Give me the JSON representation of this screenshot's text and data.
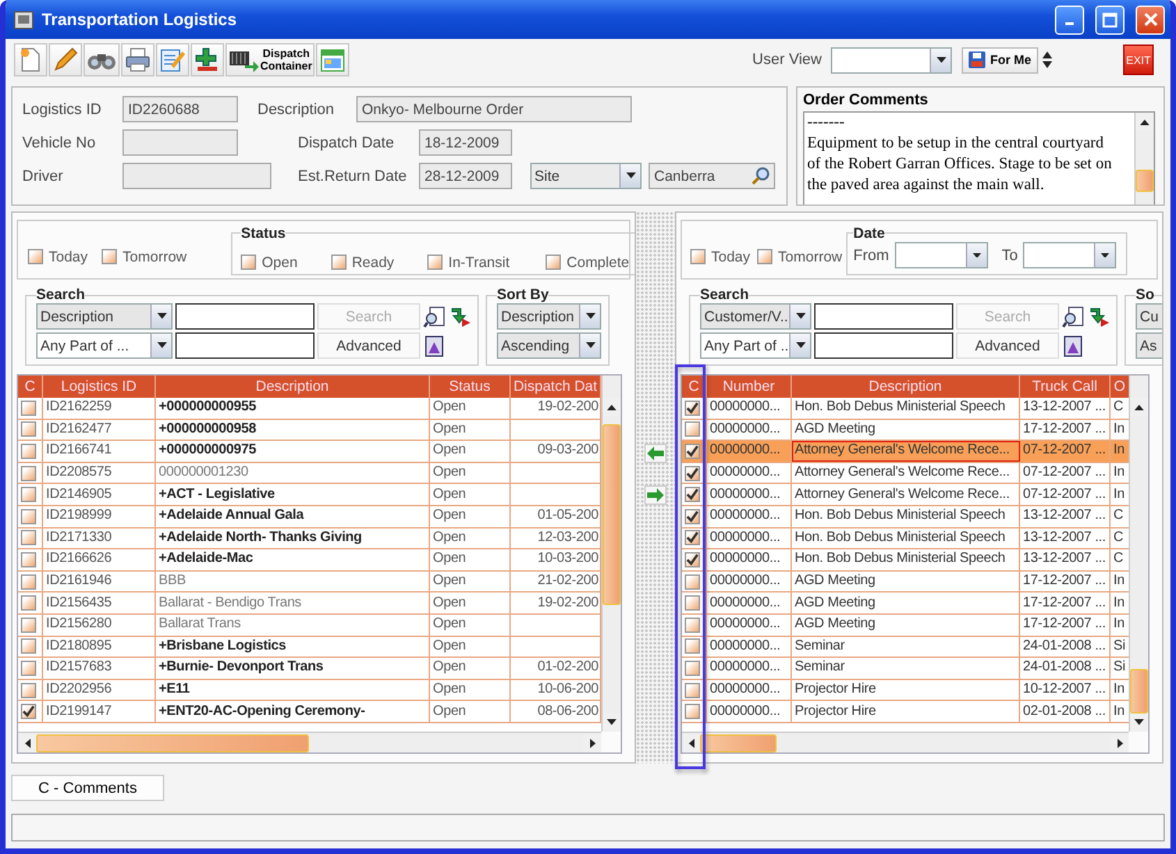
{
  "window": {
    "title": "Transportation Logistics"
  },
  "toolbar": {
    "buttons": [
      {
        "kind": "new"
      },
      {
        "kind": "edit"
      },
      {
        "kind": "find"
      },
      {
        "kind": "print"
      },
      {
        "kind": "notes"
      },
      {
        "kind": "add"
      },
      {
        "kind": "dispatch",
        "label_lines": [
          "Dispatch",
          "Container"
        ]
      },
      {
        "kind": "calendar"
      }
    ],
    "user_view_label": "User View",
    "for_me_button": "For Me",
    "exit_button": "EXIT"
  },
  "header": {
    "logistics_id": {
      "label": "Logistics ID",
      "value": "ID2260688"
    },
    "description": {
      "label": "Description",
      "value": "Onkyo- Melbourne Order"
    },
    "vehicle_no": {
      "label": "Vehicle No"
    },
    "dispatch_date": {
      "label": "Dispatch Date",
      "value": "18-12-2009"
    },
    "driver": {
      "label": "Driver"
    },
    "est_return_date": {
      "label": "Est.Return Date",
      "value": "28-12-2009"
    },
    "site_combo": "Site",
    "location": "Canberra"
  },
  "order_comments": {
    "title": "Order Comments",
    "lines": [
      "-------",
      "Equipment to be setup in the central courtyard",
      "of the Robert Garran Offices. Stage to be set on",
      "the paved area against the main wall."
    ]
  },
  "left_panel": {
    "quick_filters": [
      {
        "label": "Today",
        "checked": false
      },
      {
        "label": "Tomorrow",
        "checked": false
      }
    ],
    "status": {
      "title": "Status",
      "options": [
        {
          "label": "Open",
          "checked": false
        },
        {
          "label": "Ready",
          "checked": false
        },
        {
          "label": "In-Transit",
          "checked": false
        },
        {
          "label": "Complete",
          "checked": false
        }
      ]
    },
    "search": {
      "title": "Search",
      "field_combo": "Description",
      "match_combo": "Any Part of ...",
      "search_button": {
        "label": "Search",
        "disabled": true
      },
      "advanced_button": "Advanced"
    },
    "sort": {
      "title": "Sort By",
      "field": "Description",
      "order": "Ascending"
    },
    "table": {
      "columns": [
        "C",
        "Logistics ID",
        "Description",
        "Status",
        "Dispatch Dat"
      ],
      "rows": [
        {
          "checked": false,
          "id": "ID2162259",
          "description": "+000000000955",
          "bold": true,
          "status": "Open",
          "dispatch_date": "19-02-200"
        },
        {
          "checked": false,
          "id": "ID2162477",
          "description": "+000000000958",
          "bold": true,
          "status": "Open"
        },
        {
          "checked": false,
          "id": "ID2166741",
          "description": "+000000000975",
          "bold": true,
          "status": "Open",
          "dispatch_date": "09-03-200"
        },
        {
          "checked": false,
          "id": "ID2208575",
          "description": "000000001230",
          "bold": false,
          "status": "Open"
        },
        {
          "checked": false,
          "id": "ID2146905",
          "description": "+ACT - Legislative",
          "bold": true,
          "status": "Open"
        },
        {
          "checked": false,
          "id": "ID2198999",
          "description": "+Adelaide Annual Gala",
          "bold": true,
          "status": "Open",
          "dispatch_date": "01-05-200"
        },
        {
          "checked": false,
          "id": "ID2171330",
          "description": "+Adelaide North- Thanks Giving",
          "bold": true,
          "status": "Open",
          "dispatch_date": "12-03-200"
        },
        {
          "checked": false,
          "id": "ID2166626",
          "description": "+Adelaide-Mac",
          "bold": true,
          "status": "Open",
          "dispatch_date": "10-03-200"
        },
        {
          "checked": false,
          "id": "ID2161946",
          "description": "BBB",
          "bold": false,
          "status": "Open",
          "dispatch_date": "21-02-200"
        },
        {
          "checked": false,
          "id": "ID2156435",
          "description": "Ballarat - Bendigo Trans",
          "bold": false,
          "status": "Open",
          "dispatch_date": "19-02-200"
        },
        {
          "checked": false,
          "id": "ID2156280",
          "description": "Ballarat Trans",
          "bold": false,
          "status": "Open"
        },
        {
          "checked": false,
          "id": "ID2180895",
          "description": "+Brisbane Logistics",
          "bold": true,
          "status": "Open"
        },
        {
          "checked": false,
          "id": "ID2157683",
          "description": "+Burnie- Devonport Trans",
          "bold": true,
          "status": "Open",
          "dispatch_date": "01-02-200"
        },
        {
          "checked": false,
          "id": "ID2202956",
          "description": "+E11",
          "bold": true,
          "status": "Open",
          "dispatch_date": "10-06-200"
        },
        {
          "checked": true,
          "id": "ID2199147",
          "description": "+ENT20-AC-Opening Ceremony-",
          "bold": true,
          "status": "Open",
          "dispatch_date": "08-06-200"
        }
      ]
    }
  },
  "right_panel": {
    "quick_filters": [
      {
        "label": "Today",
        "checked": false
      },
      {
        "label": "Tomorrow",
        "checked": false
      }
    ],
    "date": {
      "title": "Date",
      "from_label": "From",
      "to_label": "To"
    },
    "search": {
      "title": "Search",
      "field_combo": "Customer/V...",
      "match_combo": "Any Part of ...",
      "search_button": {
        "label": "Search",
        "disabled": true
      },
      "advanced_button": "Advanced"
    },
    "sort": {
      "title": "So",
      "field": "Cu",
      "order": "As"
    },
    "table": {
      "columns": [
        "C",
        "Number",
        "Description",
        "Truck Call",
        "O"
      ],
      "rows": [
        {
          "checked": true,
          "selected": false,
          "number": "00000000...",
          "description": "Hon. Bob Debus Ministerial Speech",
          "truck_call": "13-12-2007 ...",
          "column_5": "C"
        },
        {
          "checked": false,
          "selected": false,
          "number": "00000000...",
          "description": "AGD Meeting",
          "truck_call": "17-12-2007 ...",
          "column_5": "In"
        },
        {
          "checked": true,
          "selected": true,
          "number": "00000000...",
          "description": "Attorney General's Welcome Rece...",
          "truck_call": "07-12-2007 ...",
          "column_5": "In"
        },
        {
          "checked": true,
          "selected": false,
          "number": "00000000...",
          "description": "Attorney General's Welcome Rece...",
          "truck_call": "07-12-2007 ...",
          "column_5": "In"
        },
        {
          "checked": true,
          "selected": false,
          "number": "00000000...",
          "description": "Attorney General's Welcome Rece...",
          "truck_call": "07-12-2007 ...",
          "column_5": "In"
        },
        {
          "checked": true,
          "selected": false,
          "number": "00000000...",
          "description": "Hon. Bob Debus Ministerial Speech",
          "truck_call": "13-12-2007 ...",
          "column_5": "C"
        },
        {
          "checked": true,
          "selected": false,
          "number": "00000000...",
          "description": "Hon. Bob Debus Ministerial Speech",
          "truck_call": "13-12-2007 ...",
          "column_5": "C"
        },
        {
          "checked": true,
          "selected": false,
          "number": "00000000...",
          "description": "Hon. Bob Debus Ministerial Speech",
          "truck_call": "13-12-2007 ...",
          "column_5": "C"
        },
        {
          "checked": false,
          "selected": false,
          "number": "00000000...",
          "description": "AGD Meeting",
          "truck_call": "17-12-2007 ...",
          "column_5": "In"
        },
        {
          "checked": false,
          "selected": false,
          "number": "00000000...",
          "description": "AGD Meeting",
          "truck_call": "17-12-2007 ...",
          "column_5": "In"
        },
        {
          "checked": false,
          "selected": false,
          "number": "00000000...",
          "description": "AGD Meeting",
          "truck_call": "17-12-2007 ...",
          "column_5": "In"
        },
        {
          "checked": false,
          "selected": false,
          "number": "00000000...",
          "description": "Seminar",
          "truck_call": "24-01-2008 ...",
          "column_5": "Si"
        },
        {
          "checked": false,
          "selected": false,
          "number": "00000000...",
          "description": "Seminar",
          "truck_call": "24-01-2008 ...",
          "column_5": "Si"
        },
        {
          "checked": false,
          "selected": false,
          "number": "00000000...",
          "description": "Projector Hire",
          "truck_call": "10-12-2007 ...",
          "column_5": "In"
        },
        {
          "checked": false,
          "selected": false,
          "number": "00000000...",
          "description": "Projector Hire",
          "truck_call": "02-01-2008 ...",
          "column_5": "In"
        }
      ]
    }
  },
  "bottom": {
    "comments_button": "C - Comments"
  }
}
